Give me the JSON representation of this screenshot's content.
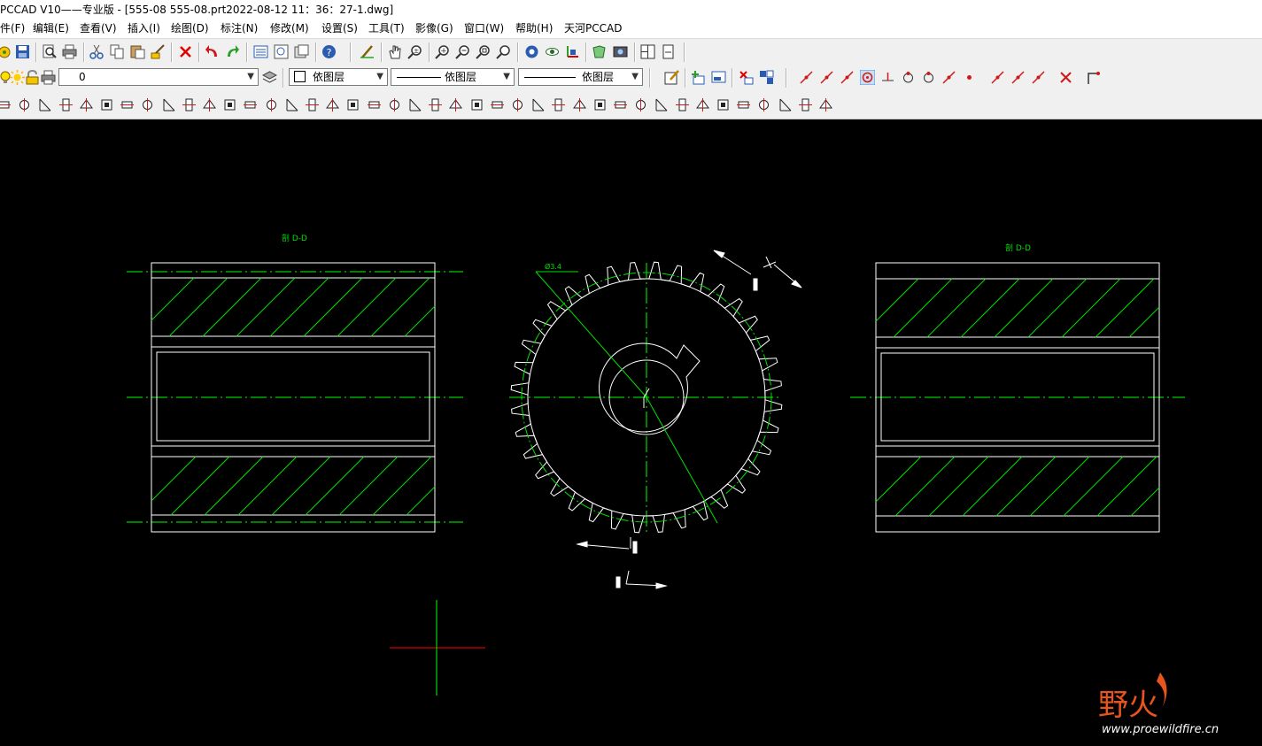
{
  "window": {
    "title": "PCCAD V10——专业版 - [555-08 555-08.prt2022-08-12 11：36：27-1.dwg]"
  },
  "menu": [
    {
      "label": "件(F)"
    },
    {
      "label": "编辑(E)"
    },
    {
      "label": "查看(V)"
    },
    {
      "label": "插入(I)"
    },
    {
      "label": "绘图(D)"
    },
    {
      "label": "标注(N)"
    },
    {
      "label": "修改(M)"
    },
    {
      "label": "设置(S)"
    },
    {
      "label": "工具(T)"
    },
    {
      "label": "影像(G)"
    },
    {
      "label": "窗口(W)"
    },
    {
      "label": "帮助(H)"
    },
    {
      "label": "天河PCCAD"
    }
  ],
  "toolbar": {
    "layer_value": "0",
    "color_value": "依图层",
    "linetype_value": "依图层",
    "lineweight_value": "依图层"
  },
  "icons": {
    "standard": [
      "open-icon",
      "save-icon",
      "print-preview-icon",
      "print-icon",
      "cut-icon",
      "copy-icon",
      "paste-icon",
      "match-properties-icon",
      "delete-icon",
      "undo-icon",
      "redo-icon",
      "properties-icon",
      "design-center-icon",
      "tool-palette-icon",
      "help-icon",
      "sketch-icon",
      "pan-icon",
      "zoom-realtime-icon",
      "zoom-in-icon",
      "zoom-out-icon",
      "zoom-window-icon",
      "zoom-extents-icon",
      "view-icon",
      "visibility-icon",
      "ucs-icon",
      "3d-view-icon",
      "camera-icon",
      "split-view-icon",
      "page-icon"
    ],
    "layer_bar": [
      "lightbulb-icon",
      "sun-icon",
      "lock-icon",
      "printer-icon",
      "layer-manager-icon",
      "edit-icon",
      "insert-block-icon",
      "block-attribute-icon",
      "explode-icon",
      "group-icon"
    ],
    "snap_bar": [
      "snap-endpoint-icon",
      "snap-midpoint-icon",
      "snap-intersection-icon",
      "snap-center-icon",
      "snap-perpendicular-icon",
      "snap-tangent-icon",
      "snap-quadrant-icon",
      "snap-insert-icon",
      "snap-node-icon",
      "snap-apparent-icon",
      "snap-extension-icon",
      "snap-nearest-icon",
      "snap-none-icon",
      "snap-settings-icon"
    ],
    "parts_bar_count": 41
  },
  "drawing": {
    "section_label_left": "剖 D-D",
    "section_label_right": "剖 D-D",
    "gear_annotation": "Ø3.4",
    "gear_teeth": 36
  },
  "watermark": {
    "logo_text": "野火",
    "url": "www.proewildfire.cn"
  },
  "colors": {
    "line": "#ffffff",
    "center": "#00ff00",
    "hatch": "#00e000",
    "cursor_h": "#ff0000",
    "cursor_v": "#00ff00",
    "watermark": "#e8541e"
  }
}
